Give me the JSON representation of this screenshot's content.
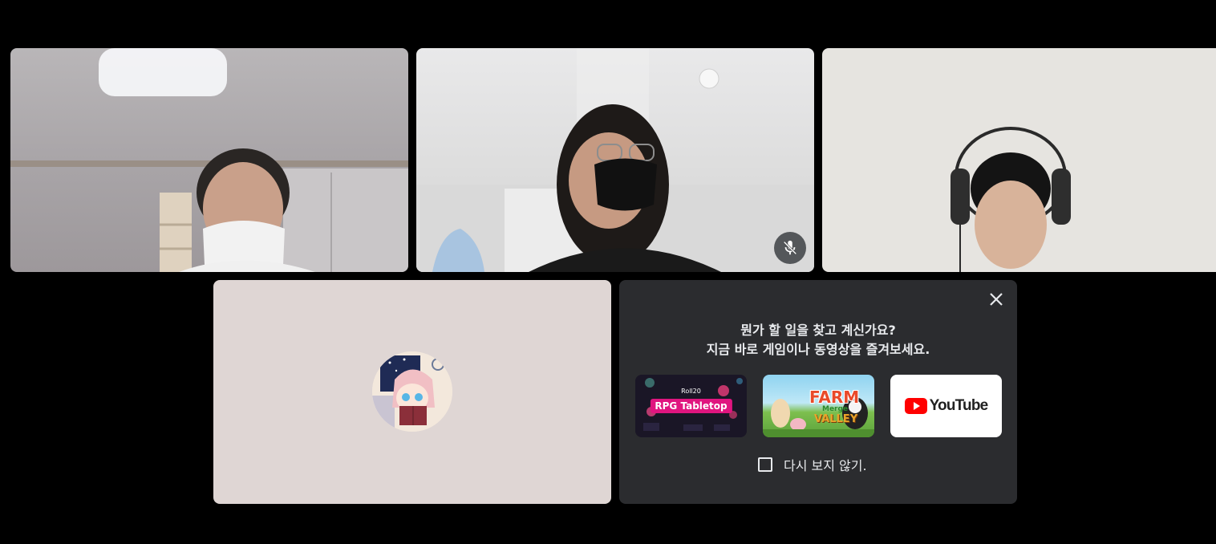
{
  "meeting": {
    "participants": [
      {
        "tile": "camera-on",
        "muted": false
      },
      {
        "tile": "camera-on",
        "muted": true
      },
      {
        "tile": "camera-on",
        "muted": false
      },
      {
        "tile": "avatar",
        "muted": false
      }
    ]
  },
  "suggestions": {
    "title_line1": "뭔가 할 일을 찾고 계신가요?",
    "title_line2": "지금 바로 게임이나 동영상을 즐겨보세요.",
    "cards": [
      {
        "brand": "Roll20",
        "label": "RPG Tabletop"
      },
      {
        "label_line1": "FARM",
        "label_line2": "Merge",
        "label_line3": "VALLEY"
      },
      {
        "label": "YouTube"
      }
    ],
    "dont_show_again": "다시 보지 않기.",
    "close_icon": "close-icon"
  },
  "colors": {
    "background": "#000000",
    "panel": "#2b2c2f",
    "avatar_tile": "#dfd6d4",
    "youtube_red": "#ff0000",
    "rpg_pink": "#e0157f"
  }
}
